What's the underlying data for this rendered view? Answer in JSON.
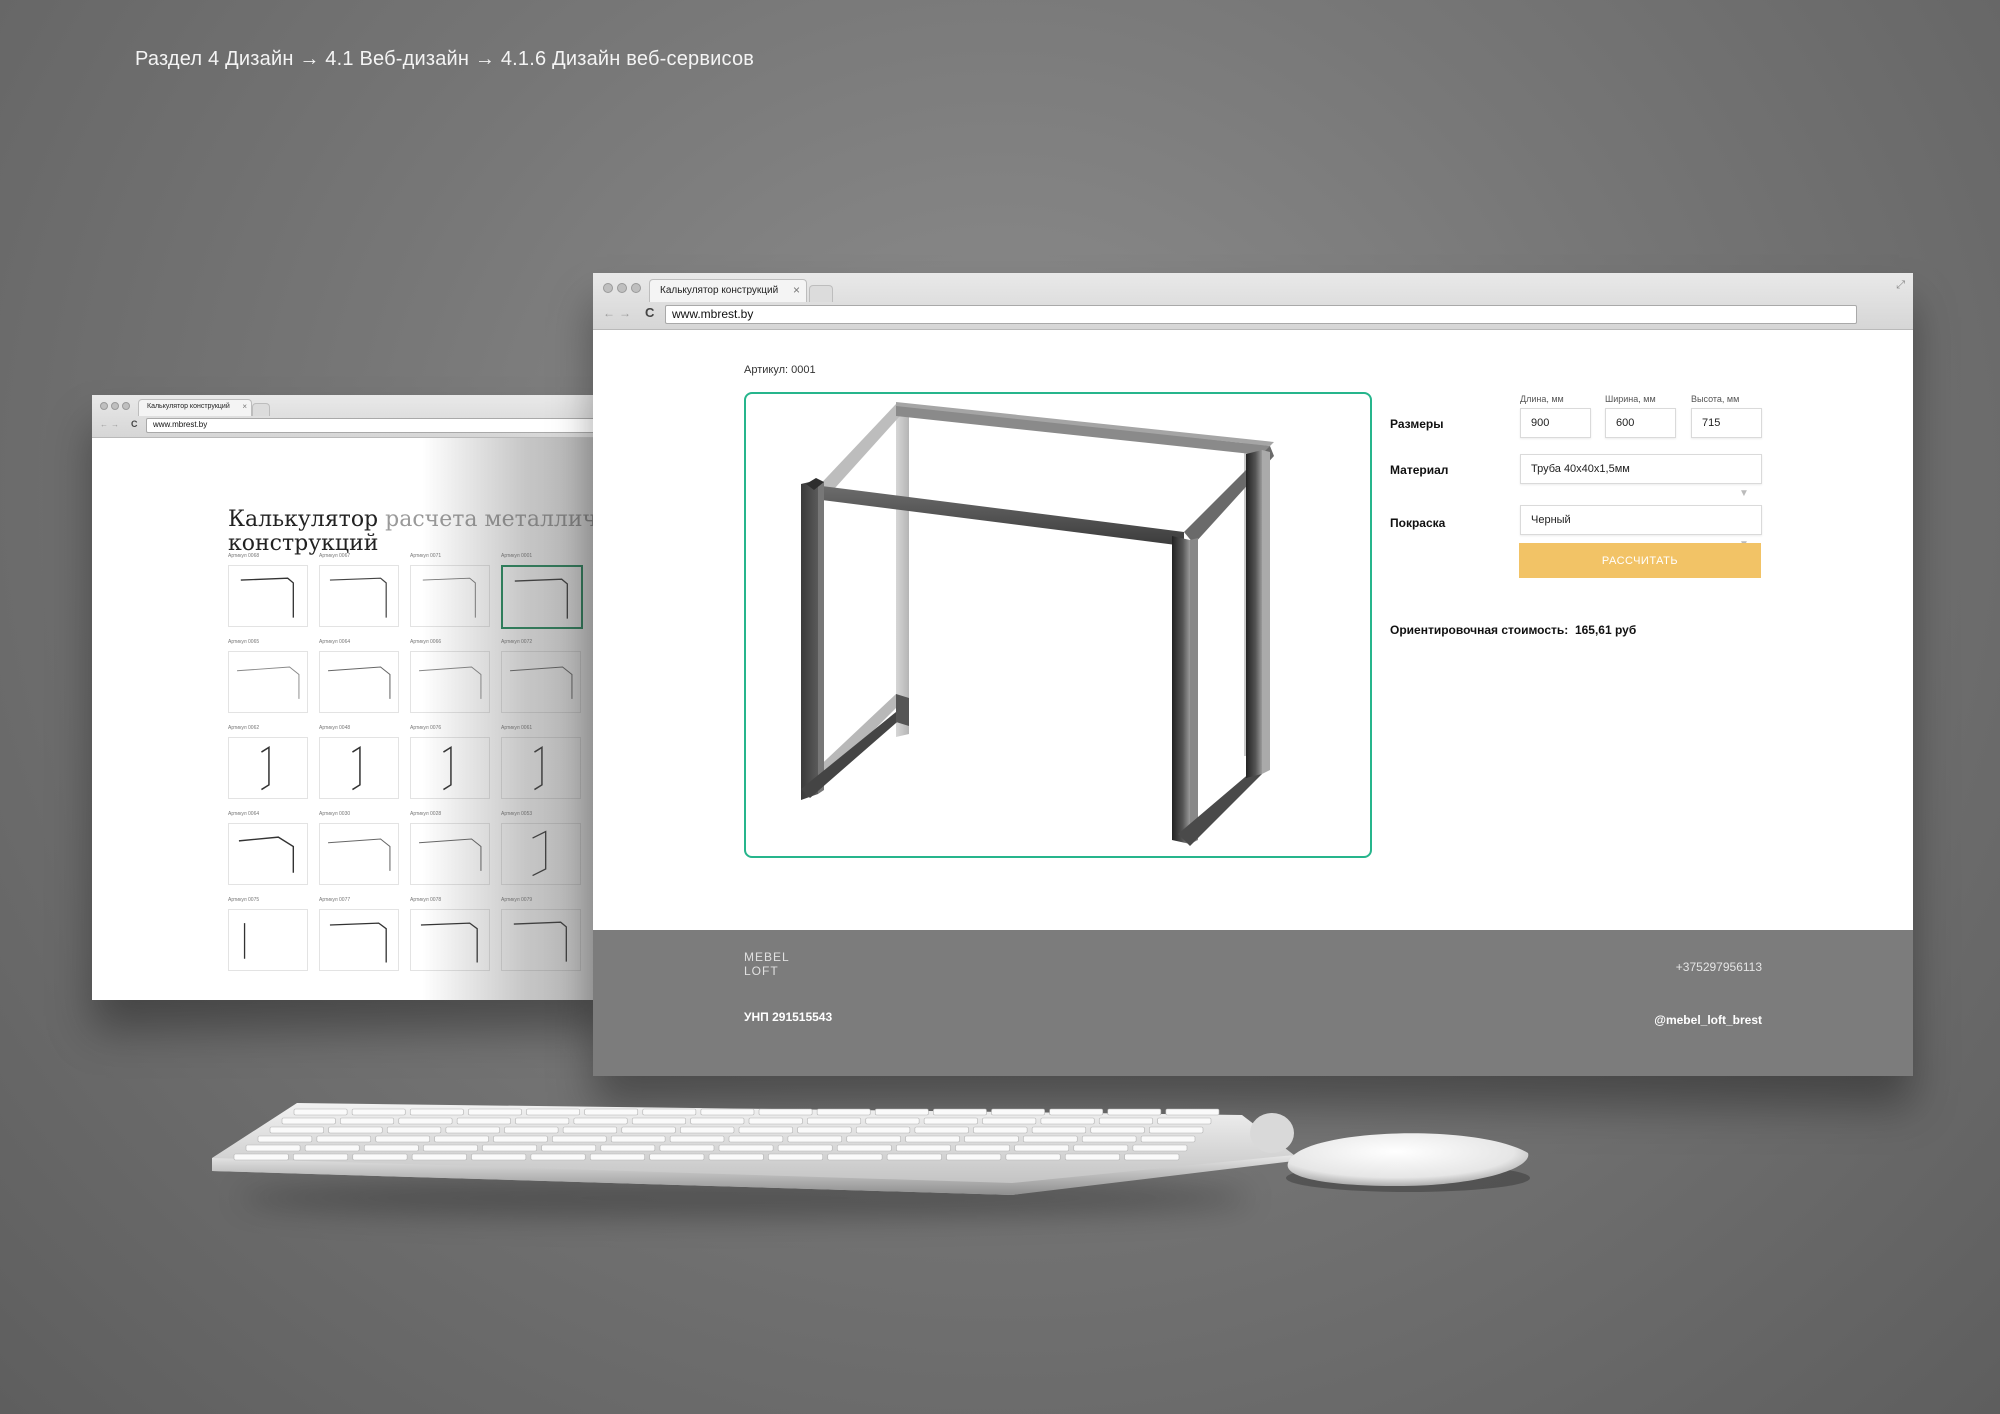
{
  "breadcrumb": "Раздел 4 Дизайн  → 4.1 Веб-дизайн → 4.1.6 Дизайн веб-сервисов",
  "back_browser": {
    "tab_title": "Калькулятор конструкций",
    "url": "www.mbrest.by",
    "title_dark": "Калькулятор",
    "title_light": "расчета металлических",
    "title_line2": "конструкций",
    "selected_index": 3,
    "thumbnails": [
      {
        "label": "Артикул 0068",
        "kind": "table"
      },
      {
        "label": "Артикул 0067",
        "kind": "table-split"
      },
      {
        "label": "Артикул 0071",
        "kind": "table-light"
      },
      {
        "label": "Артикул 0001",
        "kind": "table"
      },
      {
        "label": "Артикул 0065",
        "kind": "wide-shelf"
      },
      {
        "label": "Артикул 0064",
        "kind": "wide"
      },
      {
        "label": "Артикул 0066",
        "kind": "wide-shelf"
      },
      {
        "label": "Артикул 0072",
        "kind": "wide"
      },
      {
        "label": "Артикул 0062",
        "kind": "leg"
      },
      {
        "label": "Артикул 0048",
        "kind": "leg"
      },
      {
        "label": "Артикул 0076",
        "kind": "leg"
      },
      {
        "label": "Артикул 0061",
        "kind": "leg"
      },
      {
        "label": "Артикул 0064",
        "kind": "desk"
      },
      {
        "label": "Артикул 0030",
        "kind": "wide"
      },
      {
        "label": "Артикул 0028",
        "kind": "wide"
      },
      {
        "label": "Артикул 0053",
        "kind": "leg-frame"
      },
      {
        "label": "Артикул 0075",
        "kind": "legs"
      },
      {
        "label": "Артикул 0077",
        "kind": "cross"
      },
      {
        "label": "Артикул 0078",
        "kind": "cross"
      },
      {
        "label": "Артикул 0079",
        "kind": "table"
      }
    ]
  },
  "front_browser": {
    "tab_title": "Калькулятор конструкций",
    "url": "www.mbrest.by",
    "article": "Артикул: 0001",
    "form": {
      "sizes_label": "Размеры",
      "length_label": "Длина, мм",
      "width_label": "Ширина, мм",
      "height_label": "Высота, мм",
      "length_value": "900",
      "width_value": "600",
      "height_value": "715",
      "material_label": "Материал",
      "material_value": "Труба 40х40х1,5мм",
      "paint_label": "Покраска",
      "paint_value": "Черный",
      "calculate_button": "РАССЧИТАТЬ",
      "estimate_label": "Ориентировочная стоимость:",
      "estimate_value": "165,61 руб"
    },
    "footer": {
      "logo_line1": "MEBEL",
      "logo_line2": "LOFT",
      "unp": "УНП 291515543",
      "phone": "+375297956113",
      "instagram": "@mebel_loft_brest"
    }
  }
}
